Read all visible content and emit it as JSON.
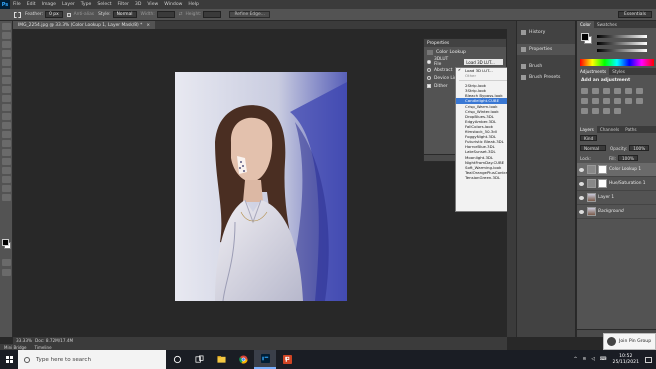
{
  "menubar": {
    "app_logo": "Ps",
    "items": [
      "File",
      "Edit",
      "Image",
      "Layer",
      "Type",
      "Select",
      "Filter",
      "3D",
      "View",
      "Window",
      "Help"
    ]
  },
  "options_bar": {
    "feather_label": "Feather:",
    "feather_value": "0 px",
    "anti_alias": "Anti-alias",
    "style_label": "Style:",
    "style_value": "Normal",
    "width_label": "Width:",
    "height_label": "Height:",
    "refine_edge": "Refine Edge...",
    "workspace": "Essentials"
  },
  "document": {
    "tab_title": "IMG_2254.jpg @ 33.3% (Color Lookup 1, Layer Mask/8) *",
    "zoom": "33.33%",
    "doc_info": "Doc: 8.72M/17.4M"
  },
  "bottom_tabs": [
    "Mini Bridge",
    "Timeline"
  ],
  "properties": {
    "header": "Properties",
    "title": "Color Lookup",
    "rows": [
      {
        "label": "3DLUT File",
        "value": "Load 3D LUT...",
        "radio": true,
        "on": true
      },
      {
        "label": "Abstract",
        "radio": true,
        "on": false
      },
      {
        "label": "Device Link",
        "radio": true,
        "on": false
      },
      {
        "label": "Dither",
        "check": true
      }
    ]
  },
  "lut_dropdown": {
    "items": [
      {
        "label": "Load 3D LUT...",
        "checked": true
      },
      {
        "label": "Other",
        "disabled": true
      },
      {
        "sep": true
      },
      {
        "label": "2Strip.look"
      },
      {
        "label": "3Strip.look"
      },
      {
        "label": "Bleach Bypass.look"
      },
      {
        "label": "Candlelight.CUBE",
        "selected": true
      },
      {
        "label": "Crisp_Warm.look"
      },
      {
        "label": "Crisp_Winter.look"
      },
      {
        "label": "DropBlues.3DL"
      },
      {
        "label": "EdgyAmber.3DL"
      },
      {
        "label": "FallColors.look"
      },
      {
        "label": "filmstock_50.3dl"
      },
      {
        "label": "FoggyNight.3DL"
      },
      {
        "label": "Futuristic Bleak.3DL"
      },
      {
        "label": "HorrorBlue.3DL"
      },
      {
        "label": "LateSunset.3DL"
      },
      {
        "label": "Moonlight.3DL"
      },
      {
        "label": "NightFromDay.CUBE"
      },
      {
        "label": "Soft_Warming.look"
      },
      {
        "label": "TealOrangePlusContrast.3DL"
      },
      {
        "label": "TensionGreen.3DL"
      }
    ]
  },
  "dock": {
    "items": [
      "History",
      "Properties",
      "Brush",
      "Brush Presets"
    ]
  },
  "right_panel": {
    "color_tabs": [
      "Color",
      "Swatches"
    ],
    "adj_tabs": [
      "Adjustments",
      "Styles"
    ],
    "adj_title": "Add an adjustment",
    "layers_tabs": [
      "Layers",
      "Channels",
      "Paths"
    ],
    "kind_label": "Kind",
    "blend_mode": "Normal",
    "opacity_label": "Opacity:",
    "opacity_value": "100%",
    "lock_label": "Lock:",
    "fill_label": "Fill:",
    "fill_value": "100%",
    "layers": [
      {
        "name": "Color Lookup 1",
        "thumb": "adj",
        "active": true
      },
      {
        "name": "Hue/Saturation 1",
        "thumb": "adj",
        "active": false
      },
      {
        "name": "Layer 1",
        "thumb": "photo",
        "active": false
      },
      {
        "name": "Background",
        "thumb": "photo",
        "active": false
      }
    ]
  },
  "notification": {
    "text": "Join Pin Group"
  },
  "taskbar": {
    "search_placeholder": "Type here to search",
    "time": "10:52",
    "date": "25/11/2021"
  }
}
